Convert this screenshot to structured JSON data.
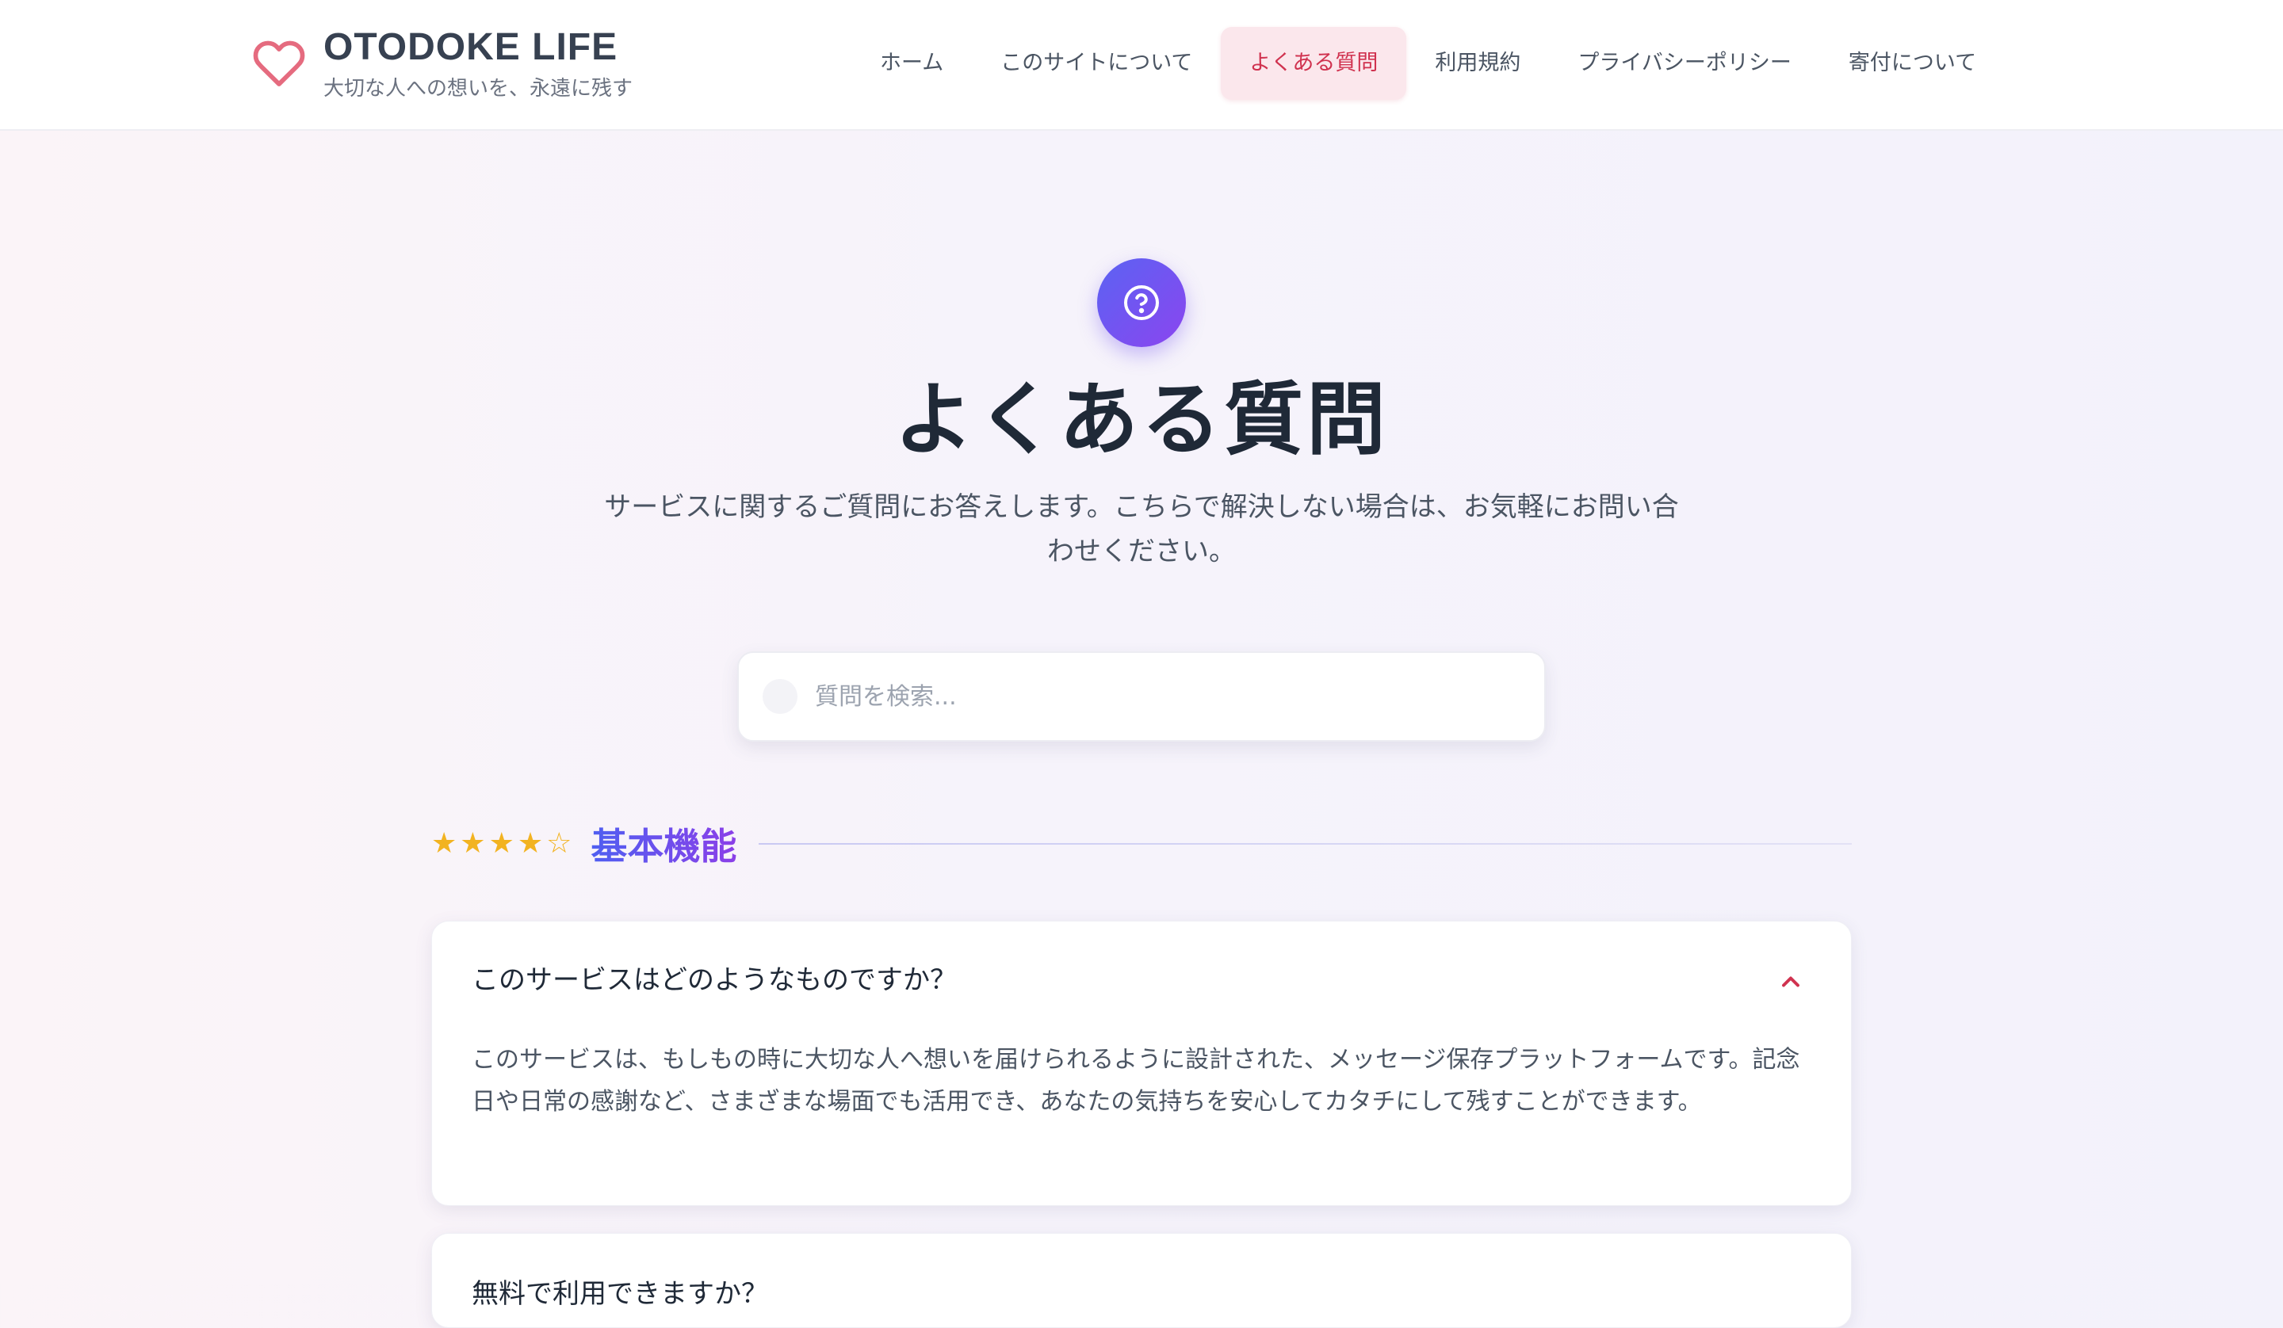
{
  "brand": {
    "title": "OTODOKE LIFE",
    "tagline": "大切な人への想いを、永遠に残す",
    "icon": "heart-outline-icon",
    "accent": "#e56b7f"
  },
  "nav": {
    "items": [
      {
        "label": "ホーム",
        "active": false
      },
      {
        "label": "このサイトについて",
        "active": false
      },
      {
        "label": "よくある質問",
        "active": true
      },
      {
        "label": "利用規約",
        "active": false
      },
      {
        "label": "プライバシーポリシー",
        "active": false
      },
      {
        "label": "寄付について",
        "active": false
      }
    ],
    "active_color": "#d0324f"
  },
  "hero": {
    "icon": "question-circle-icon",
    "title": "よくある質問",
    "description": "サービスに関するご質問にお答えします。こちらで解決しない場合は、お気軽にお問い合わせください。"
  },
  "search": {
    "placeholder": "質問を検索...",
    "value": ""
  },
  "category": {
    "rating": 4,
    "rating_max": 5,
    "title": "基本機能"
  },
  "faqs": [
    {
      "question": "このサービスはどのようなものですか？",
      "answer": "このサービスは、もしもの時に大切な人へ想いを届けられるように設計された、メッセージ保存プラットフォームです。記念日や日常の感謝など、さまざまな場面でも活用でき、あなたの気持ちを安心してカタチにして残すことができます。",
      "expanded": true
    },
    {
      "question": "無料で利用できますか？",
      "expanded": false
    }
  ]
}
